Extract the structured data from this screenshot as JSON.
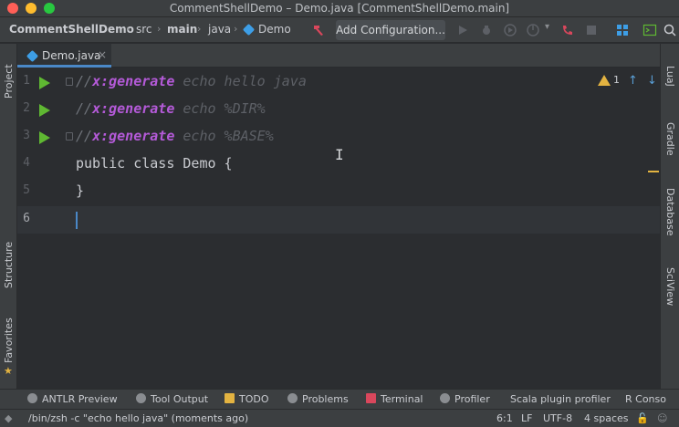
{
  "window": {
    "title": "CommentShellDemo – Demo.java [CommentShellDemo.main]"
  },
  "breadcrumbs": [
    {
      "label": "CommentShellDemo"
    },
    {
      "label": "src"
    },
    {
      "label": "main"
    },
    {
      "label": "java"
    },
    {
      "label": "Demo"
    }
  ],
  "toolbar": {
    "add_configuration": "Add Configuration..."
  },
  "left_panels": {
    "project": "Project",
    "structure": "Structure",
    "favorites": "Favorites"
  },
  "right_panels": {
    "luaj": "LuaJ",
    "gradle": "Gradle",
    "database": "Database",
    "sciview": "SciView"
  },
  "tabs": [
    {
      "label": "Demo.java",
      "close": "×"
    }
  ],
  "editor": {
    "lines": [
      {
        "num": "1",
        "prefix": "//",
        "tag": "x:generate",
        "arg": " echo hello java"
      },
      {
        "num": "2",
        "prefix": "//",
        "tag": "x:generate",
        "arg": " echo %DIR%"
      },
      {
        "num": "3",
        "prefix": "//",
        "tag": "x:generate",
        "arg": " echo %BASE%"
      },
      {
        "num": "4",
        "text": "public class Demo {"
      },
      {
        "num": "5",
        "text": "}"
      },
      {
        "num": "6",
        "text": ""
      }
    ],
    "warnings_count": "1",
    "up_arrow": "↑",
    "down_arrow": "↓"
  },
  "tool_windows": [
    {
      "label": "ANTLR Preview"
    },
    {
      "label": "Tool Output"
    },
    {
      "label": "TODO"
    },
    {
      "label": "Problems"
    },
    {
      "label": "Terminal"
    },
    {
      "label": "Profiler"
    },
    {
      "label": "Scala plugin profiler"
    },
    {
      "label": "R Conso"
    }
  ],
  "status": {
    "message": "/bin/zsh -c \"echo hello java\" (moments ago)",
    "position": "6:1",
    "line_separator": "LF",
    "encoding": "UTF-8",
    "indent": "4 spaces"
  },
  "colors": {
    "run_green": "#5fb832",
    "accent_blue": "#4a88c7",
    "tag_purple": "#b45ad8",
    "warning_yellow": "#e3b341"
  }
}
